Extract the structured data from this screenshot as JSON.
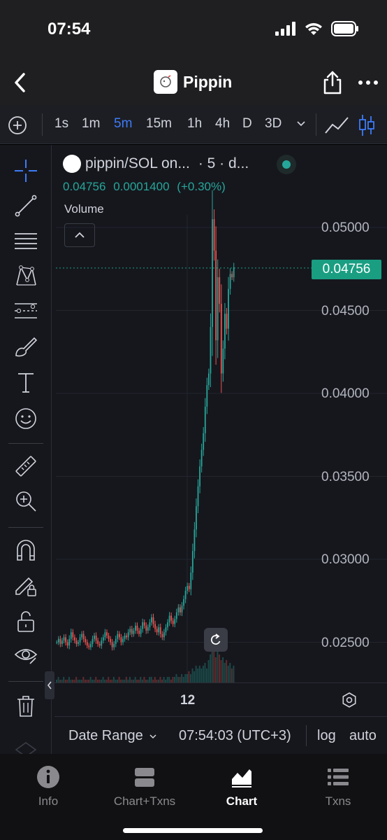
{
  "status": {
    "time": "07:54"
  },
  "nav": {
    "title": "Pippin"
  },
  "toolbar": {
    "intervals": [
      "1s",
      "1m",
      "5m",
      "15m",
      "1h",
      "4h",
      "D",
      "3D"
    ],
    "active_interval": "5m"
  },
  "legend": {
    "title": "pippin/SOL on...",
    "suffix": "· 5 · d...",
    "last": "0.04756",
    "change": "0.0001400",
    "change_pct": "(+0.30%)",
    "volume_label": "Volume"
  },
  "price_axis": {
    "ticks": [
      "0.05000",
      "0.04500",
      "0.04000",
      "0.03500",
      "0.03000",
      "0.02500"
    ],
    "current_price": "0.04756"
  },
  "time_axis": {
    "label": "12"
  },
  "footer": {
    "date_range": "Date Range",
    "clock": "07:54:03 (UTC+3)",
    "log": "log",
    "auto": "auto"
  },
  "tabs": [
    {
      "label": "Info",
      "icon": "info-icon"
    },
    {
      "label": "Chart+Txns",
      "icon": "split-view-icon"
    },
    {
      "label": "Chart",
      "icon": "area-chart-icon"
    },
    {
      "label": "Txns",
      "icon": "list-icon"
    }
  ],
  "active_tab": "Chart",
  "colors": {
    "up": "#26a69a",
    "down": "#ef5350",
    "accent": "#3d7bf7",
    "price_tag": "#1a9e82"
  },
  "chart_data": {
    "type": "candlestick",
    "ylim": [
      0.0235,
      0.0525
    ],
    "points": [
      0.025,
      0.0252,
      0.0249,
      0.0251,
      0.0253,
      0.025,
      0.0248,
      0.0252,
      0.0256,
      0.0253,
      0.0251,
      0.0249,
      0.025,
      0.0253,
      0.0255,
      0.0252,
      0.025,
      0.0248,
      0.0247,
      0.0249,
      0.0252,
      0.0254,
      0.0251,
      0.0249,
      0.0248,
      0.0251,
      0.0253,
      0.0256,
      0.0254,
      0.0252,
      0.025,
      0.0247,
      0.0249,
      0.0252,
      0.0255,
      0.0253,
      0.025,
      0.0252,
      0.0254,
      0.0253,
      0.0256,
      0.0258,
      0.0255,
      0.0257,
      0.026,
      0.0257,
      0.0255,
      0.0258,
      0.0262,
      0.026,
      0.0257,
      0.0259,
      0.0262,
      0.0265,
      0.0261,
      0.0258,
      0.0256,
      0.0259,
      0.0255,
      0.0253,
      0.0256,
      0.0259,
      0.0262,
      0.0266,
      0.0263,
      0.0261,
      0.0264,
      0.0268,
      0.0271,
      0.0268,
      0.0272,
      0.0276,
      0.0281,
      0.0284,
      0.0282,
      0.0292,
      0.0305,
      0.0318,
      0.0332,
      0.0344,
      0.0356,
      0.0366,
      0.0376,
      0.0392,
      0.0405,
      0.0412,
      0.044,
      0.0505,
      0.0486,
      0.0432,
      0.047,
      0.0454,
      0.0412,
      0.0427,
      0.0448,
      0.0439,
      0.0463,
      0.0472,
      0.047,
      0.0476
    ],
    "volumes": [
      1,
      2,
      1,
      1,
      2,
      1,
      1,
      2,
      1,
      1,
      1,
      2,
      1,
      1,
      1,
      2,
      1,
      1,
      1,
      2,
      1,
      1,
      2,
      1,
      1,
      1,
      2,
      1,
      1,
      2,
      1,
      1,
      2,
      1,
      1,
      2,
      1,
      1,
      1,
      2,
      1,
      2,
      1,
      1,
      2,
      1,
      1,
      2,
      1,
      2,
      1,
      1,
      2,
      2,
      1,
      2,
      1,
      1,
      2,
      1,
      2,
      1,
      2,
      2,
      1,
      2,
      2,
      3,
      2,
      2,
      3,
      2,
      3,
      3,
      4,
      3,
      5,
      4,
      6,
      5,
      6,
      5,
      6,
      7,
      5,
      8,
      10,
      14,
      12,
      9,
      11,
      10,
      8,
      9,
      7,
      8,
      6,
      7,
      5,
      6
    ]
  }
}
